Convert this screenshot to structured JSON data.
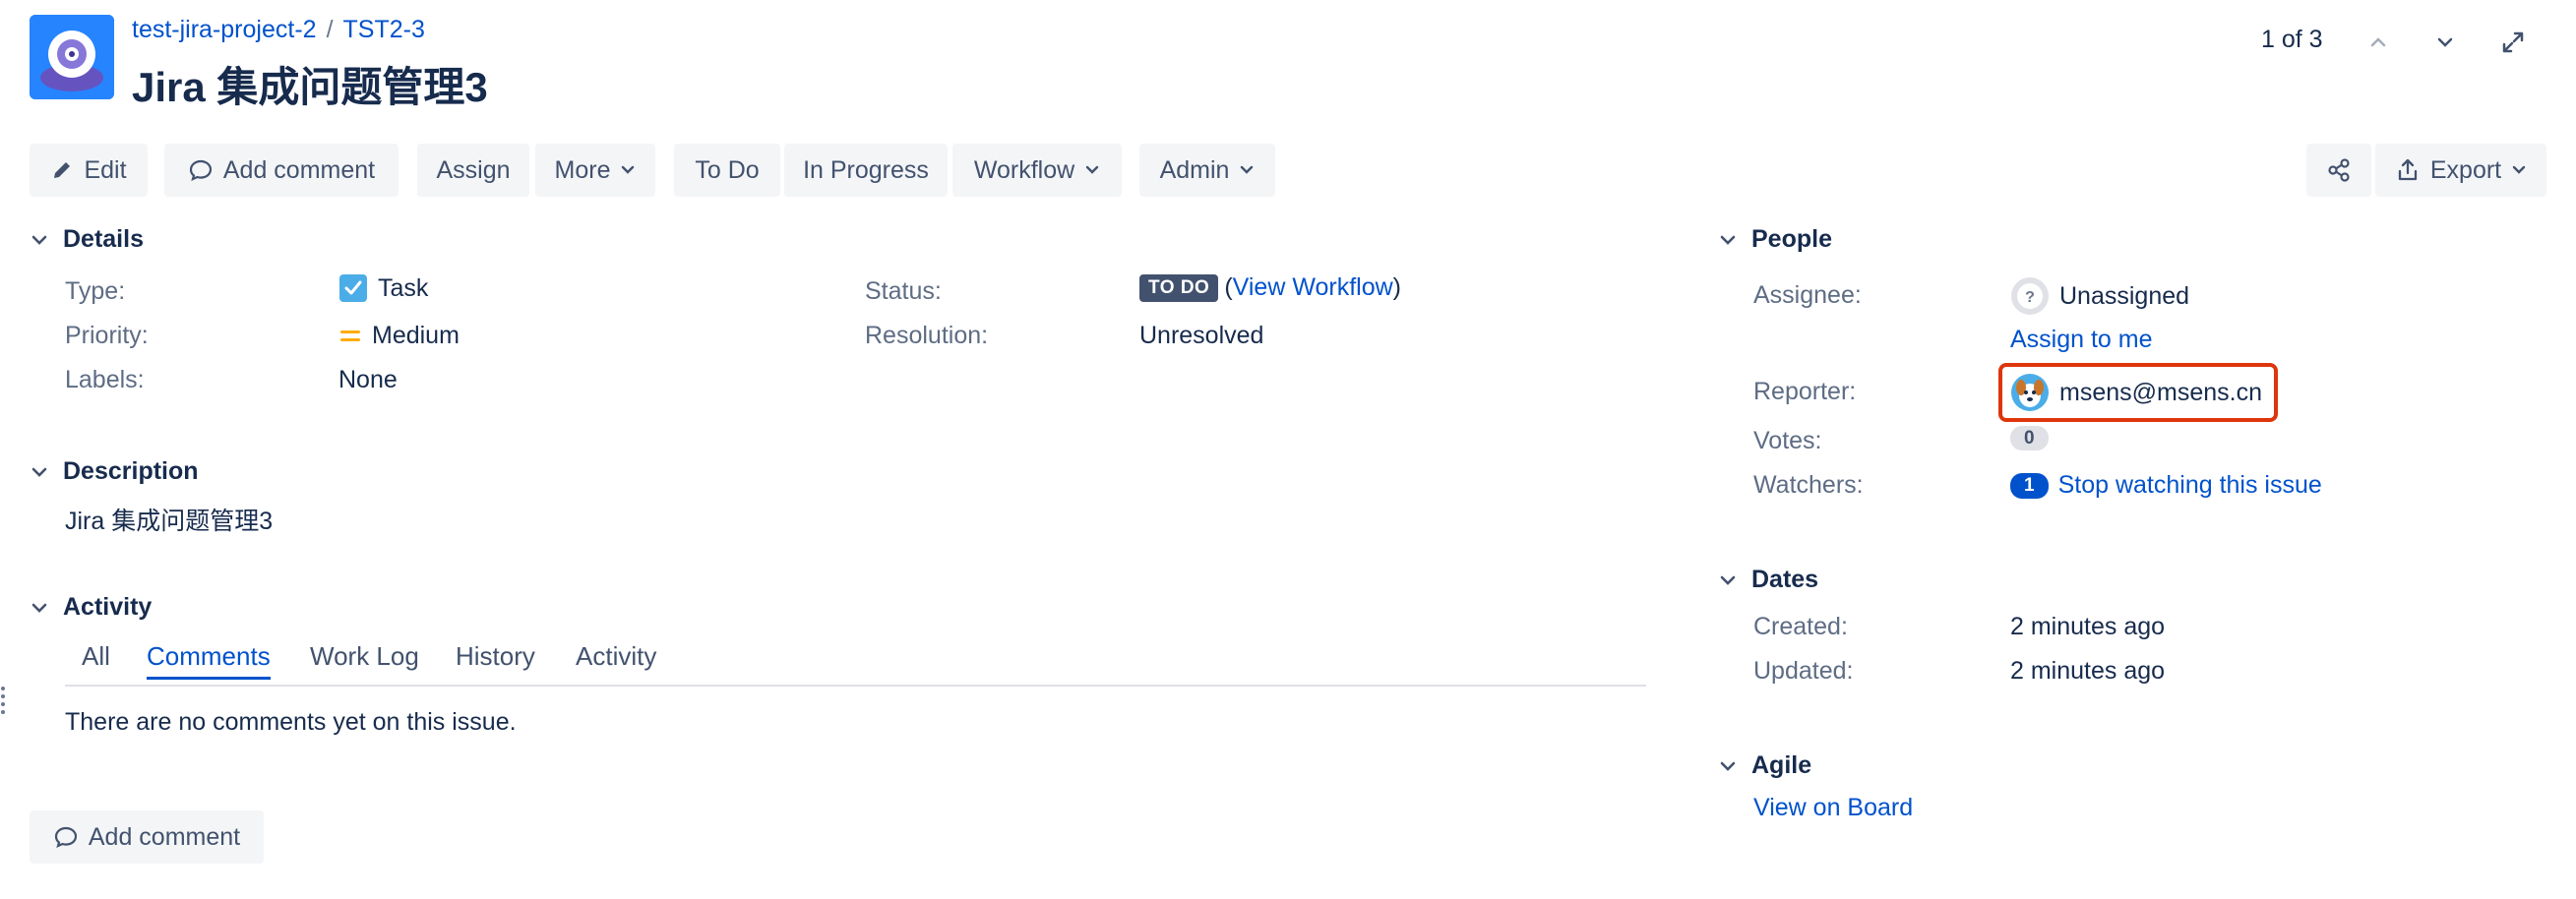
{
  "header": {
    "project_link": "test-jira-project-2",
    "separator": "/",
    "issue_key": "TST2-3",
    "title": "Jira 集成问题管理3",
    "pager_text": "1 of 3"
  },
  "toolbar": {
    "edit": "Edit",
    "add_comment": "Add comment",
    "assign": "Assign",
    "more": "More",
    "todo": "To Do",
    "in_progress": "In Progress",
    "workflow": "Workflow",
    "admin": "Admin",
    "export": "Export"
  },
  "details": {
    "heading": "Details",
    "type_label": "Type:",
    "type_value": "Task",
    "priority_label": "Priority:",
    "priority_value": "Medium",
    "labels_label": "Labels:",
    "labels_value": "None",
    "status_label": "Status:",
    "status_value": "TO DO",
    "paren_open": "(",
    "view_workflow": "View Workflow",
    "paren_close": ")",
    "resolution_label": "Resolution:",
    "resolution_value": "Unresolved"
  },
  "description": {
    "heading": "Description",
    "text": "Jira 集成问题管理3"
  },
  "activity": {
    "heading": "Activity",
    "tabs": [
      "All",
      "Comments",
      "Work Log",
      "History",
      "Activity"
    ],
    "active_tab": "Comments",
    "empty_text": "There are no comments yet on this issue.",
    "add_comment": "Add comment"
  },
  "people": {
    "heading": "People",
    "assignee_label": "Assignee:",
    "assignee_value": "Unassigned",
    "assign_to_me": "Assign to me",
    "reporter_label": "Reporter:",
    "reporter_value": "msens@msens.cn",
    "votes_label": "Votes:",
    "votes_value": "0",
    "watchers_label": "Watchers:",
    "watchers_count": "1",
    "stop_watching": "Stop watching this issue"
  },
  "dates": {
    "heading": "Dates",
    "created_label": "Created:",
    "created_value": "2 minutes ago",
    "updated_label": "Updated:",
    "updated_value": "2 minutes ago"
  },
  "agile": {
    "heading": "Agile",
    "view_on_board": "View on Board"
  },
  "colors": {
    "link": "#0052cc",
    "text": "#172b4d",
    "label": "#5e6c84",
    "button_bg": "#f4f5f7",
    "lozenge_todo": "#42526e",
    "highlight": "#de350b",
    "priority_medium": "#ffab00"
  },
  "icons": [
    "project-avatar-icon",
    "pencil-icon",
    "comment-icon",
    "chevron-down-icon",
    "share-icon",
    "export-icon",
    "chevron-up-icon",
    "expand-icon",
    "task-checkbox-icon",
    "priority-medium-icon",
    "unassigned-avatar-icon",
    "reporter-avatar-icon"
  ]
}
